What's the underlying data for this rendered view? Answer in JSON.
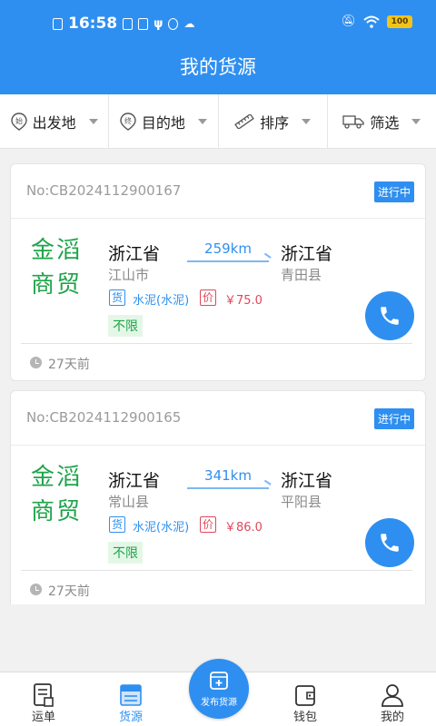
{
  "status_bar": {
    "time": "16:58",
    "battery": "100"
  },
  "header": {
    "title": "我的货源"
  },
  "filters": [
    {
      "label": "出发地",
      "icon": "origin-icon",
      "icon_text": "始"
    },
    {
      "label": "目的地",
      "icon": "destination-icon",
      "icon_text": "终"
    },
    {
      "label": "排序",
      "icon": "ruler-icon"
    },
    {
      "label": "筛选",
      "icon": "truck-icon"
    }
  ],
  "cards": [
    {
      "order_no": "No:CB2024112900167",
      "status": "进行中",
      "logo_lines": [
        "金滔",
        "商贸"
      ],
      "from_province": "浙江省",
      "from_city": "江山市",
      "distance": "259km",
      "to_province": "浙江省",
      "to_city": "青田县",
      "goods_tag": "货",
      "goods": "水泥(水泥)",
      "price_tag": "价",
      "price": "￥75.0",
      "limit": "不限",
      "time": "27天前"
    },
    {
      "order_no": "No:CB2024112900165",
      "status": "进行中",
      "logo_lines": [
        "金滔",
        "商贸"
      ],
      "from_province": "浙江省",
      "from_city": "常山县",
      "distance": "341km",
      "to_province": "浙江省",
      "to_city": "平阳县",
      "goods_tag": "货",
      "goods": "水泥(水泥)",
      "price_tag": "价",
      "price": "￥86.0",
      "limit": "不限",
      "time": "27天前"
    }
  ],
  "tabs": [
    {
      "label": "运单",
      "icon": "waybill-icon"
    },
    {
      "label": "货源",
      "icon": "cargo-icon",
      "active": true
    },
    {
      "label": "",
      "icon": "placeholder"
    },
    {
      "label": "钱包",
      "icon": "wallet-icon"
    },
    {
      "label": "我的",
      "icon": "user-icon"
    }
  ],
  "publish": {
    "label": "发布货源"
  },
  "colors": {
    "primary": "#2f8ff0",
    "green": "#1fa44a",
    "red": "#e0475b"
  }
}
